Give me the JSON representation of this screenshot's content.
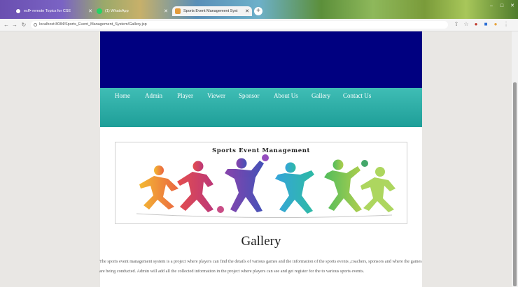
{
  "browser": {
    "tabs": [
      {
        "title": "ecff• remote Topics for CSE"
      },
      {
        "title": "(1) WhatsApp"
      },
      {
        "title": "Sports Event Management Syst"
      }
    ],
    "url": "localhost:8084/Sports_Event_Management_System/Gallery.jsp"
  },
  "nav": {
    "items": [
      "Home",
      "Admin",
      "Player",
      "Viewer",
      "Sponsor",
      "About Us",
      "Gallery",
      "Contact Us"
    ]
  },
  "poster": {
    "title": "Sports Event Management"
  },
  "gallery": {
    "heading": "Gallery",
    "description": "The sports event management system is a project where players can find the details of various games and the information of the sports events ,coachers, sponsors and where the games are being conducted. Admin will add all the collected information in the project where players can see and get register for the to various sports events."
  },
  "colors": {
    "banner": "#000080",
    "navbar": "#2aaaa4"
  }
}
